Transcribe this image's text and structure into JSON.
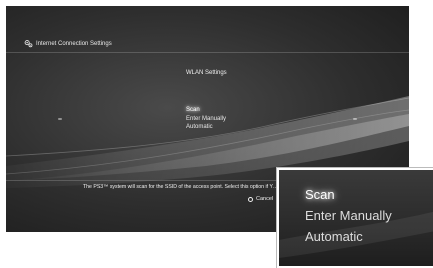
{
  "screen": {
    "header_title": "Internet Connection Settings",
    "subtitle": "WLAN Settings",
    "menu": [
      {
        "label": "Scan",
        "selected": true
      },
      {
        "label": "Enter Manually",
        "selected": false
      },
      {
        "label": "Automatic",
        "selected": false
      }
    ],
    "description": "The PS3™ system will scan for the SSID of the access point. Select this option if Y…",
    "cancel_label": "Cancel"
  },
  "zoom": {
    "items": [
      {
        "label": "Scan",
        "selected": true
      },
      {
        "label": "Enter Manually",
        "selected": false
      },
      {
        "label": "Automatic",
        "selected": false
      }
    ]
  },
  "icons": {
    "header": "settings-gears-icon",
    "cancel": "circle-button-icon"
  }
}
